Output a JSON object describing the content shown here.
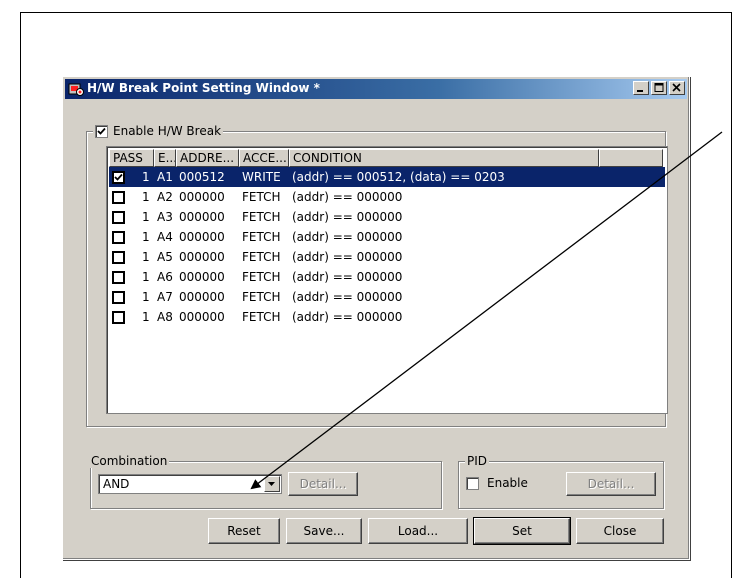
{
  "window": {
    "title": "H/W Break Point Setting Window *"
  },
  "enable_group": {
    "label": "Enable H/W Break",
    "checked": true
  },
  "table": {
    "columns": [
      "PASS",
      "E...",
      "ADDRE...",
      "ACCE...",
      "CONDITION"
    ],
    "rows": [
      {
        "checked": true,
        "pass": "1",
        "e": "A1",
        "address": "000512",
        "access": "WRITE",
        "condition": "(addr) == 000512, (data) == 0203",
        "selected": true
      },
      {
        "checked": false,
        "pass": "1",
        "e": "A2",
        "address": "000000",
        "access": "FETCH",
        "condition": "(addr) == 000000",
        "selected": false
      },
      {
        "checked": false,
        "pass": "1",
        "e": "A3",
        "address": "000000",
        "access": "FETCH",
        "condition": "(addr) == 000000",
        "selected": false
      },
      {
        "checked": false,
        "pass": "1",
        "e": "A4",
        "address": "000000",
        "access": "FETCH",
        "condition": "(addr) == 000000",
        "selected": false
      },
      {
        "checked": false,
        "pass": "1",
        "e": "A5",
        "address": "000000",
        "access": "FETCH",
        "condition": "(addr) == 000000",
        "selected": false
      },
      {
        "checked": false,
        "pass": "1",
        "e": "A6",
        "address": "000000",
        "access": "FETCH",
        "condition": "(addr) == 000000",
        "selected": false
      },
      {
        "checked": false,
        "pass": "1",
        "e": "A7",
        "address": "000000",
        "access": "FETCH",
        "condition": "(addr) == 000000",
        "selected": false
      },
      {
        "checked": false,
        "pass": "1",
        "e": "A8",
        "address": "000000",
        "access": "FETCH",
        "condition": "(addr) == 000000",
        "selected": false
      }
    ]
  },
  "combination": {
    "label": "Combination",
    "value": "AND",
    "detail_label": "Detail..."
  },
  "pid": {
    "label": "PID",
    "enable_label": "Enable",
    "enable_checked": false,
    "detail_label": "Detail..."
  },
  "buttons": {
    "reset": "Reset",
    "save": "Save...",
    "load": "Load...",
    "set": "Set",
    "close": "Close"
  },
  "colors": {
    "title_start": "#0a246a",
    "title_end": "#a6caf0",
    "selection": "#0a246a",
    "face": "#d4d0c8"
  }
}
